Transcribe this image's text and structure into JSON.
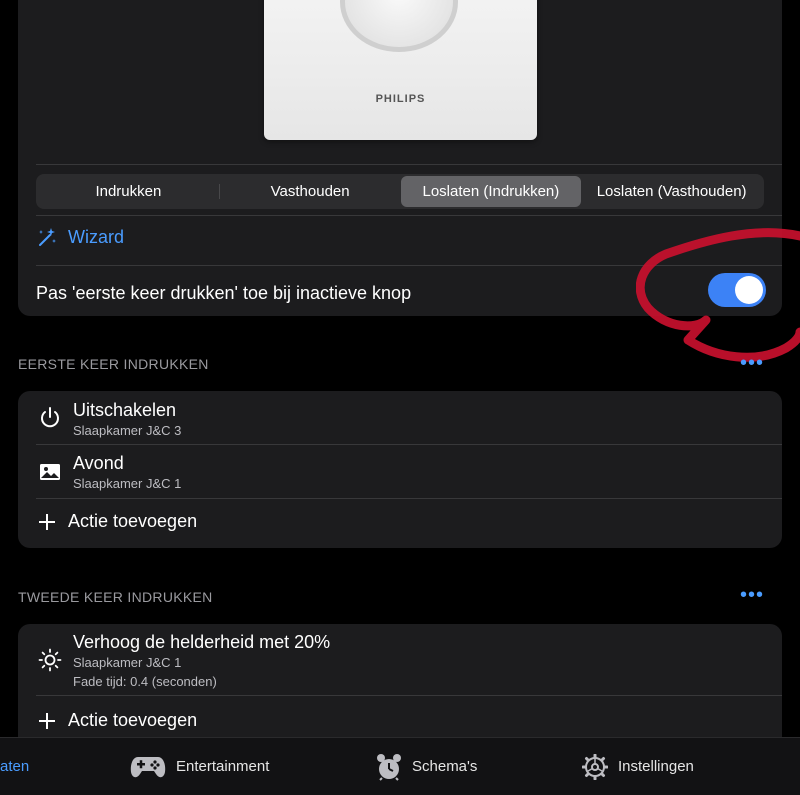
{
  "device": {
    "logo": "hue",
    "brand": "PHILIPS"
  },
  "segmented": {
    "items": [
      "Indrukken",
      "Vasthouden",
      "Loslaten (Indrukken)",
      "Loslaten (Vasthouden)"
    ],
    "selected": "Loslaten (Indrukken)"
  },
  "wizard": {
    "label": "Wizard"
  },
  "toggle_row": {
    "label": "Pas 'eerste keer drukken' toe bij inactieve knop",
    "on": true
  },
  "section1": {
    "header": "EERSTE KEER INDRUKKEN",
    "more": "•••",
    "items": [
      {
        "icon": "power-icon",
        "title": "Uitschakelen",
        "subtitle": "Slaapkamer J&C 3"
      },
      {
        "icon": "image-icon",
        "title": "Avond",
        "subtitle": "Slaapkamer J&C 1"
      }
    ],
    "add_label": "Actie toevoegen"
  },
  "section2": {
    "header": "TWEEDE KEER INDRUKKEN",
    "more": "•••",
    "items": [
      {
        "icon": "brightness-icon",
        "title": "Verhoog de helderheid met 20%",
        "subtitle": "Slaapkamer J&C 1",
        "detail": "Fade tijd: 0.4 (seconden)"
      }
    ],
    "add_label": "Actie toevoegen"
  },
  "tabbar": {
    "items": [
      {
        "label": "aten",
        "icon": "",
        "active": true
      },
      {
        "label": "Entertainment",
        "icon": "gamepad-icon",
        "active": false
      },
      {
        "label": "Schema's",
        "icon": "alarm-clock-icon",
        "active": false
      },
      {
        "label": "Instellingen",
        "icon": "gear-icon",
        "active": false
      }
    ]
  },
  "colors": {
    "accent": "#4a9cff",
    "toggle_on": "#3c82f6",
    "card": "#1c1c1e",
    "annotation": "#c8102e"
  }
}
